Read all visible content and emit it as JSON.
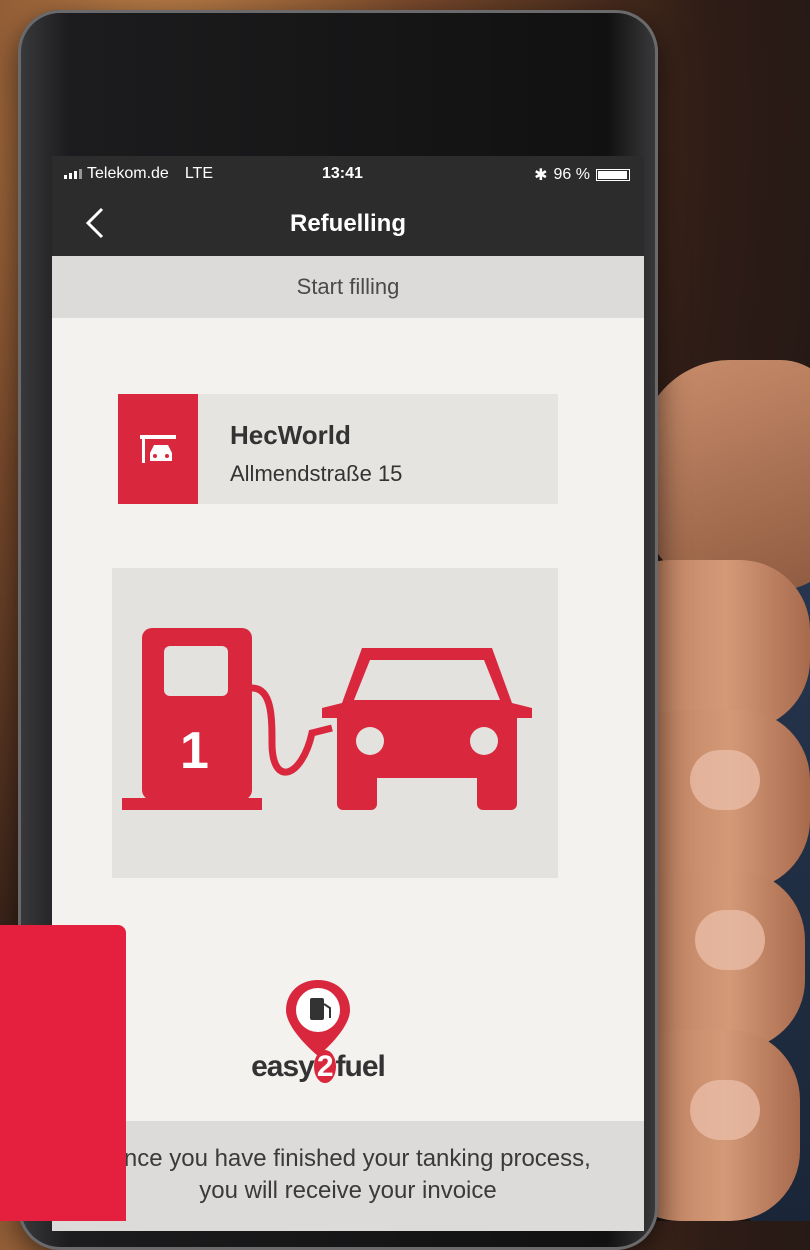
{
  "status_bar": {
    "carrier": "Telekom.de",
    "network": "LTE",
    "time": "13:41",
    "battery": "96 %",
    "battery_level": 0.96
  },
  "nav": {
    "title": "Refuelling",
    "back_icon": "chevron-left-icon"
  },
  "subheader": {
    "label": "Start filling"
  },
  "station": {
    "name": "HecWorld",
    "address": "Allmendstraße 15",
    "icon": "gas-station-icon"
  },
  "pump": {
    "number": "1"
  },
  "brand": {
    "name_prefix": "easy",
    "name_digit": "2",
    "name_suffix": "fuel"
  },
  "footer": {
    "line1": "Once you have finished your tanking process,",
    "line2": "you will receive your invoice"
  },
  "colors": {
    "accent": "#d9283e",
    "header_bg": "#2c2c2c",
    "screen_bg": "#f4f2ef"
  }
}
